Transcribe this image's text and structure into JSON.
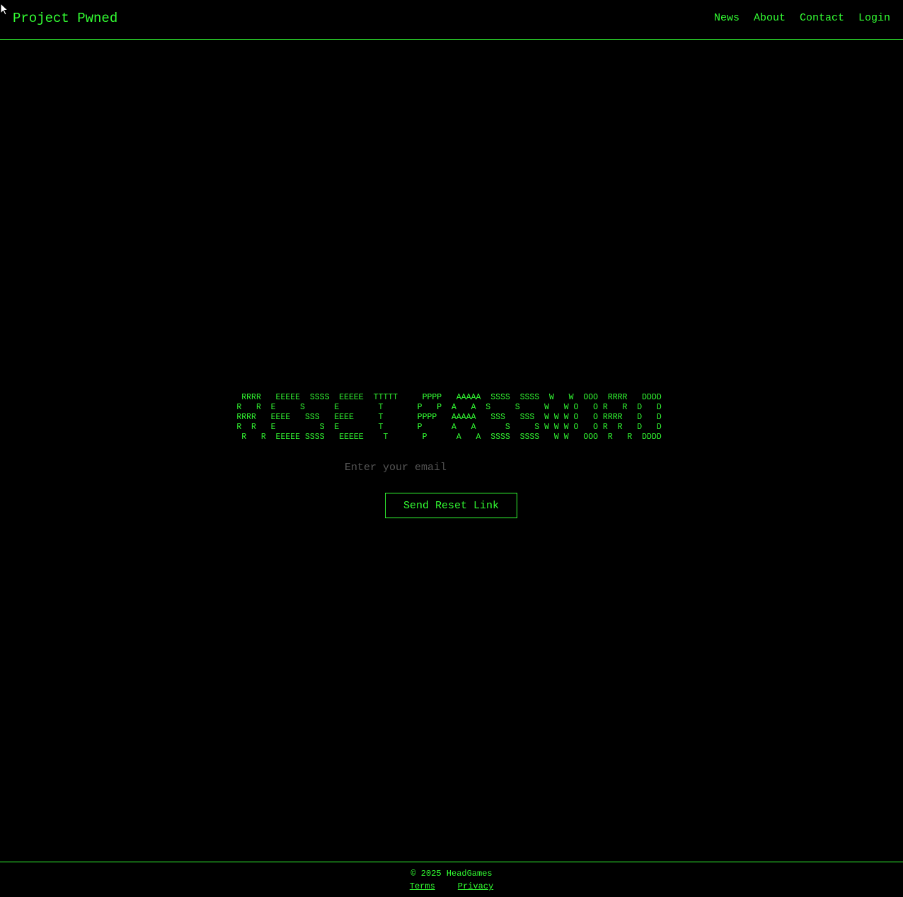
{
  "header": {
    "brand": "Project Pwned",
    "nav": [
      "News",
      "About",
      "Contact",
      "Login"
    ]
  },
  "main": {
    "ascii_banner": " RRRR   EEEEE  SSSS  EEEEE  TTTTT     PPPP   AAAAA  SSSS  SSSS  W   W  OOO  RRRR   DDDD \nR   R  E     S      E        T       P   P  A   A  S     S     W   W O   O R   R  D   D\nRRRR   EEEE   SSS   EEEE     T       PPPP   AAAAA   SSS   SSS  W W W O   O RRRR   D   D\nR  R   E         S  E        T       P      A   A      S     S W W W O   O R  R   D   D\n R   R  EEEEE SSSS   EEEEE    T       P      A   A  SSSS  SSSS   W W   OOO  R   R  DDDD ",
    "email_placeholder": "Enter your email",
    "button_label": "Send Reset Link"
  },
  "footer": {
    "copyright": "© 2025 HeadGames",
    "links": [
      "Terms",
      "Privacy"
    ]
  },
  "colors": {
    "accent": "#33ff33",
    "background": "#000000",
    "placeholder": "#555555"
  }
}
